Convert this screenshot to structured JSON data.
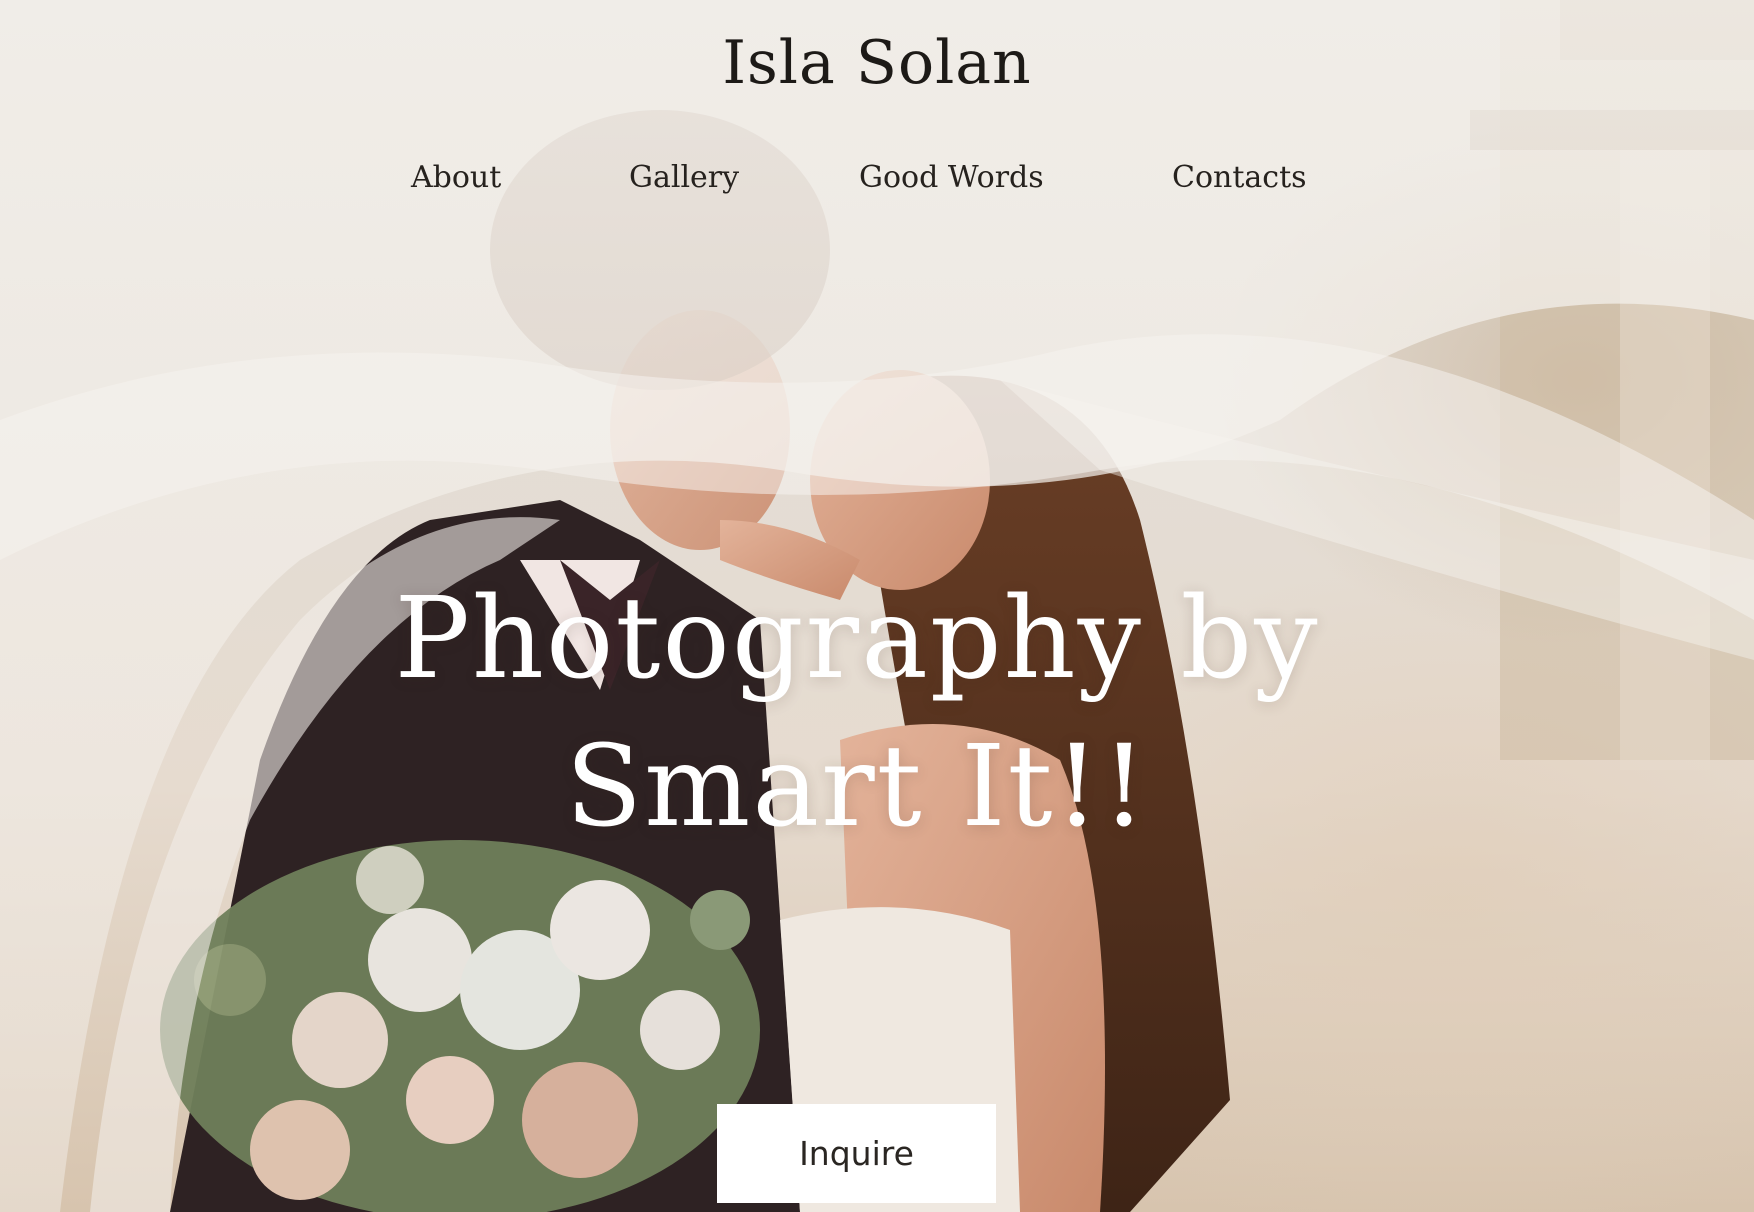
{
  "header": {
    "site_title": "Isla Solan"
  },
  "nav": {
    "items": [
      {
        "label": "About"
      },
      {
        "label": "Gallery"
      },
      {
        "label": "Good Words"
      },
      {
        "label": "Contacts"
      }
    ]
  },
  "hero": {
    "headline_line1": "Photography by",
    "headline_line2": "Smart It!!",
    "cta_label": "Inquire",
    "text_color": "#ffffff",
    "title_color": "#1d1a17"
  }
}
